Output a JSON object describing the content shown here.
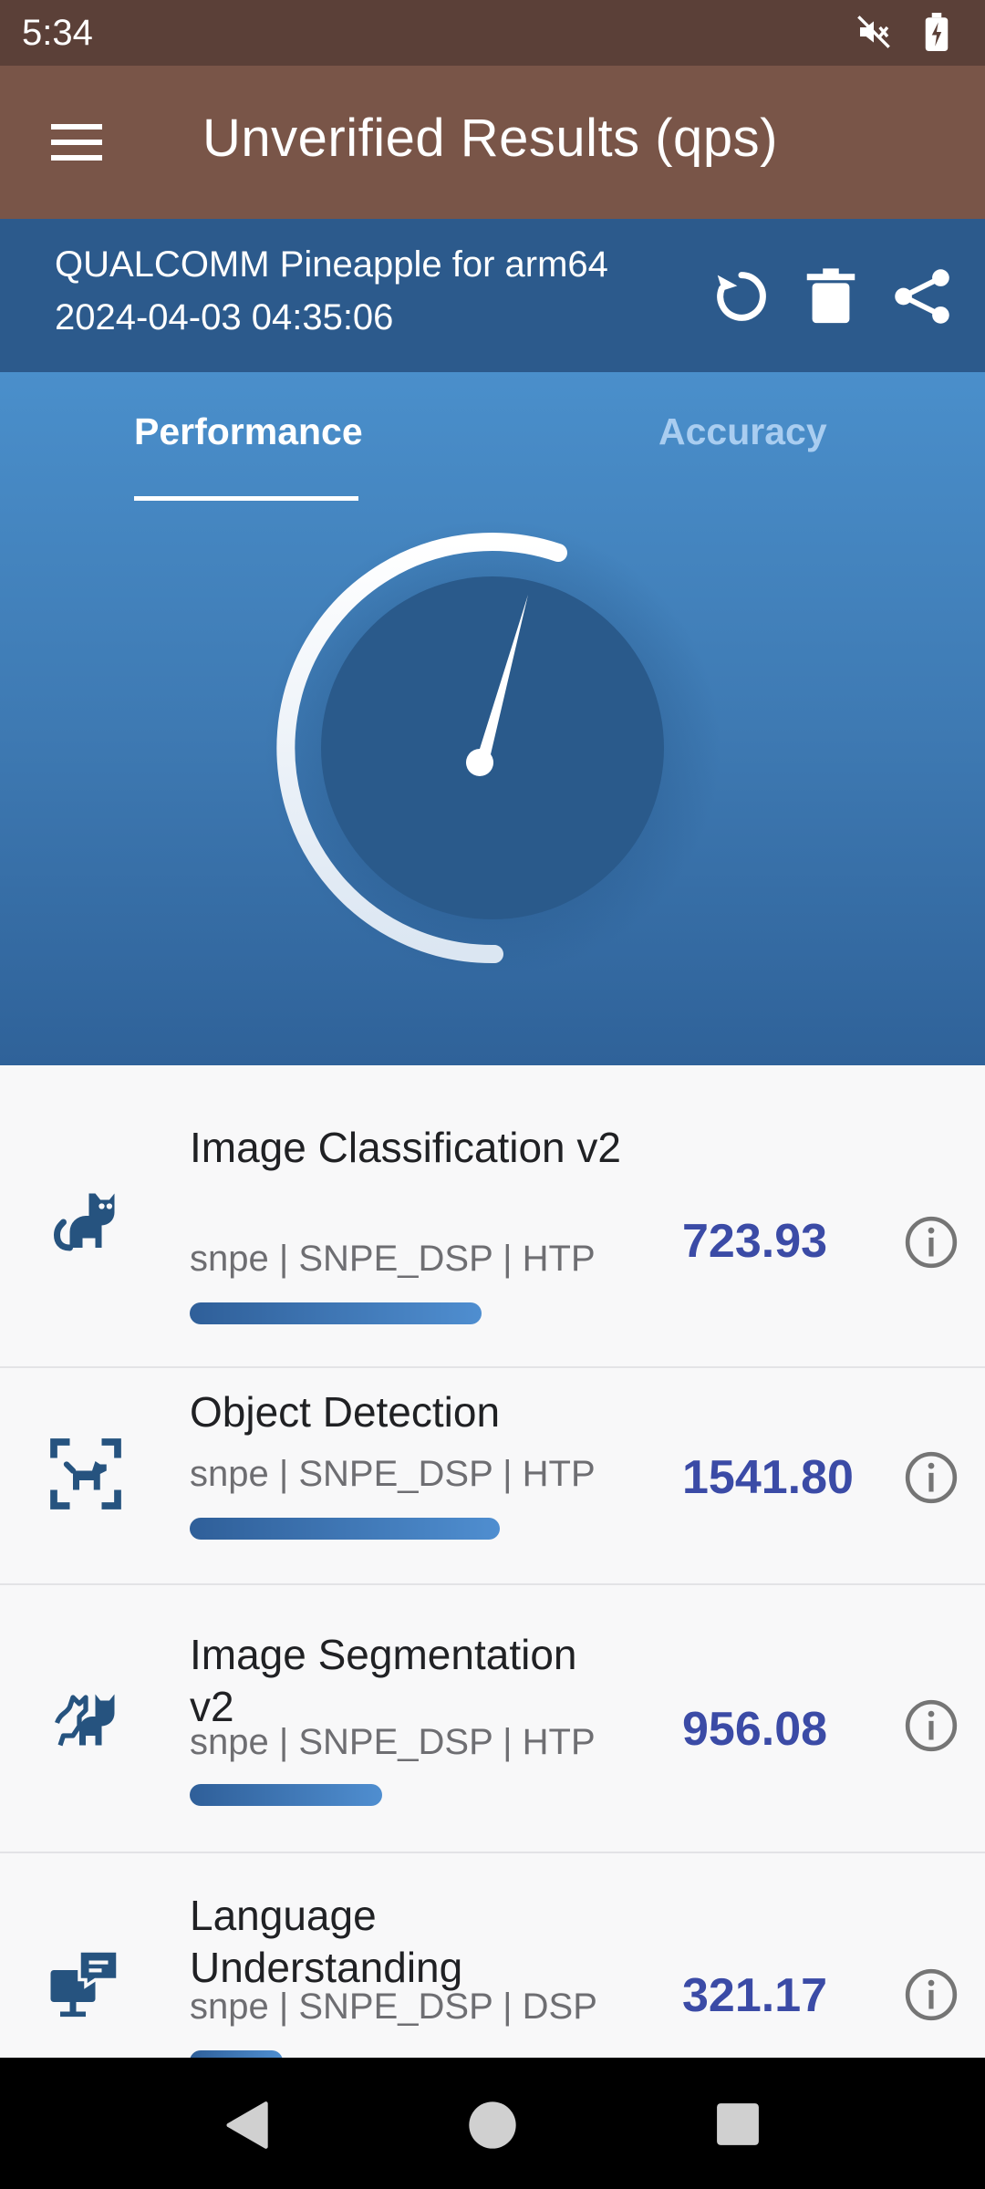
{
  "status_bar": {
    "time": "5:34",
    "icons": [
      "mute-icon",
      "battery-charging-icon"
    ]
  },
  "app_bar": {
    "title": "Unverified Results (qps)",
    "menu_icon": "hamburger-menu-icon"
  },
  "device_header": {
    "device": "QUALCOMM Pineapple for arm64",
    "datetime": "2024-04-03 04:35:06",
    "actions": [
      "rerun-icon",
      "delete-icon",
      "share-icon"
    ]
  },
  "tabs": [
    {
      "label": "Performance",
      "selected": true
    },
    {
      "label": "Accuracy",
      "selected": false
    }
  ],
  "gauge": {
    "icon": "speedometer-gauge-icon"
  },
  "results": [
    {
      "name": "Image Classification v2",
      "details": "snpe | SNPE_DSP | HTP",
      "score": "723.93",
      "bar_fraction": 0.47,
      "icon": "cat-icon"
    },
    {
      "name": "Object Detection",
      "details": "snpe | SNPE_DSP | HTP",
      "score": "1541.80",
      "bar_fraction": 0.5,
      "icon": "dog-detect-icon"
    },
    {
      "name": "Image Segmentation v2",
      "details": "snpe | SNPE_DSP | HTP",
      "score": "956.08",
      "bar_fraction": 0.31,
      "icon": "segmentation-icon"
    },
    {
      "name": "Language Understanding",
      "details": "snpe | SNPE_DSP | DSP",
      "score": "321.17",
      "bar_fraction": 0.15,
      "icon": "computer-chat-icon"
    }
  ],
  "nav_bar": {
    "buttons": [
      "back-icon",
      "home-icon",
      "recents-icon"
    ]
  },
  "colors": {
    "status_bar": "#5b4038",
    "app_bar": "#795548",
    "device_header": "#2c5a8c",
    "hero_top": "#4a8fcb",
    "hero_bottom": "#2f6299",
    "score_text": "#3b4ba6"
  }
}
